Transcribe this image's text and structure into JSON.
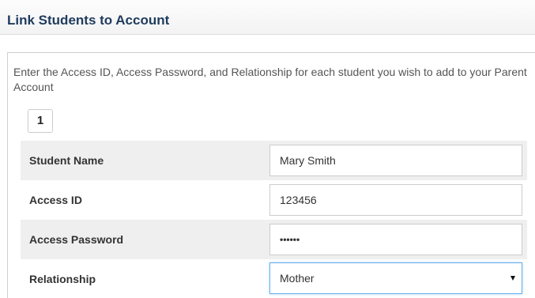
{
  "header": {
    "title": "Link Students to Account"
  },
  "instructions": "Enter the Access ID, Access Password, and Relationship for each student you wish to add to your Parent Account",
  "student": {
    "number": "1",
    "rows": [
      {
        "label": "Student Name",
        "value": "Mary Smith"
      },
      {
        "label": "Access ID",
        "value": "123456"
      },
      {
        "label": "Access Password",
        "value": "••••••"
      },
      {
        "label": "Relationship",
        "value": "Mother"
      }
    ]
  },
  "icons": {
    "relationship_dropdown": "caret-down-icon"
  }
}
